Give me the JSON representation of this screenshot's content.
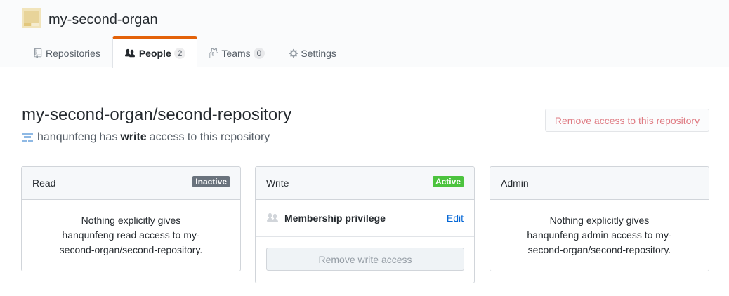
{
  "org": {
    "name": "my-second-organ",
    "avatar_color": "#e8d49a"
  },
  "tabs": [
    {
      "label": "Repositories",
      "icon": "repo-icon",
      "selected": false
    },
    {
      "label": "People",
      "icon": "people-icon",
      "count": "2",
      "selected": true
    },
    {
      "label": "Teams",
      "icon": "jersey-icon",
      "count": "0",
      "selected": false
    },
    {
      "label": "Settings",
      "icon": "gear-icon",
      "selected": false
    }
  ],
  "page": {
    "repo_title": "my-second-organ/second-repository",
    "user": "hanqunfeng",
    "has_text": "has",
    "permission": "write",
    "suffix_text": "access to this repository",
    "remove_repo_button": "Remove access to this repository"
  },
  "boxes": {
    "read": {
      "title": "Read",
      "state": "Inactive",
      "lines": [
        "Nothing explicitly gives",
        "hanqunfeng read access to my-",
        "second-organ/second-repository."
      ]
    },
    "write": {
      "title": "Write",
      "state": "Active",
      "privilege": "Membership privilege",
      "edit": "Edit",
      "remove_button": "Remove write access"
    },
    "admin": {
      "title": "Admin",
      "lines": [
        "Nothing explicitly gives",
        "hanqunfeng admin access to my-",
        "second-organ/second-repository."
      ]
    }
  },
  "colors": {
    "accent_tab": "#e36209",
    "active": "#4cc33e",
    "inactive": "#6a737d",
    "danger": "#cb2431",
    "link": "#0366d6"
  }
}
